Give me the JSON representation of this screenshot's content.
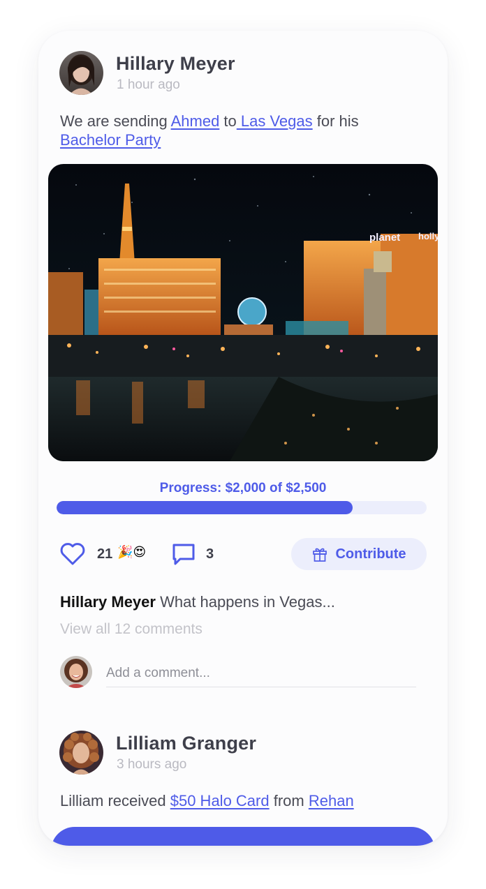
{
  "post1": {
    "author": "Hillary Meyer",
    "time": "1 hour ago",
    "caption": {
      "prefix": "We are sending ",
      "person": "Ahmed",
      "middle": " to",
      "place": " Las Vegas",
      "for_text": " for his",
      "event": "Bachelor Party"
    },
    "progress": {
      "label": "Progress: $2,000 of $2,500",
      "fraction": 0.8
    },
    "likes": {
      "count": "21",
      "emoji": "🎉😍"
    },
    "comments_count": "3",
    "contribute_label": "Contribute",
    "top_comment": {
      "author": "Hillary Meyer",
      "text": " What happens in Vegas..."
    },
    "view_all": "View all 12 comments",
    "add_comment_placeholder": "Add a comment..."
  },
  "post2": {
    "author": "Lilliam Granger",
    "time": "3 hours ago",
    "caption": {
      "prefix": "Lilliam received ",
      "gift": "$50 Halo Card",
      "middle": " from ",
      "sender": "Rehan"
    }
  },
  "colors": {
    "accent": "#4e5be8",
    "accent_soft": "#eceefc",
    "text": "#3e3f4a",
    "muted": "#b9b9c1"
  },
  "icons": {
    "like": "heart-icon",
    "comment": "speech-bubble-icon",
    "contribute": "gift-icon"
  }
}
